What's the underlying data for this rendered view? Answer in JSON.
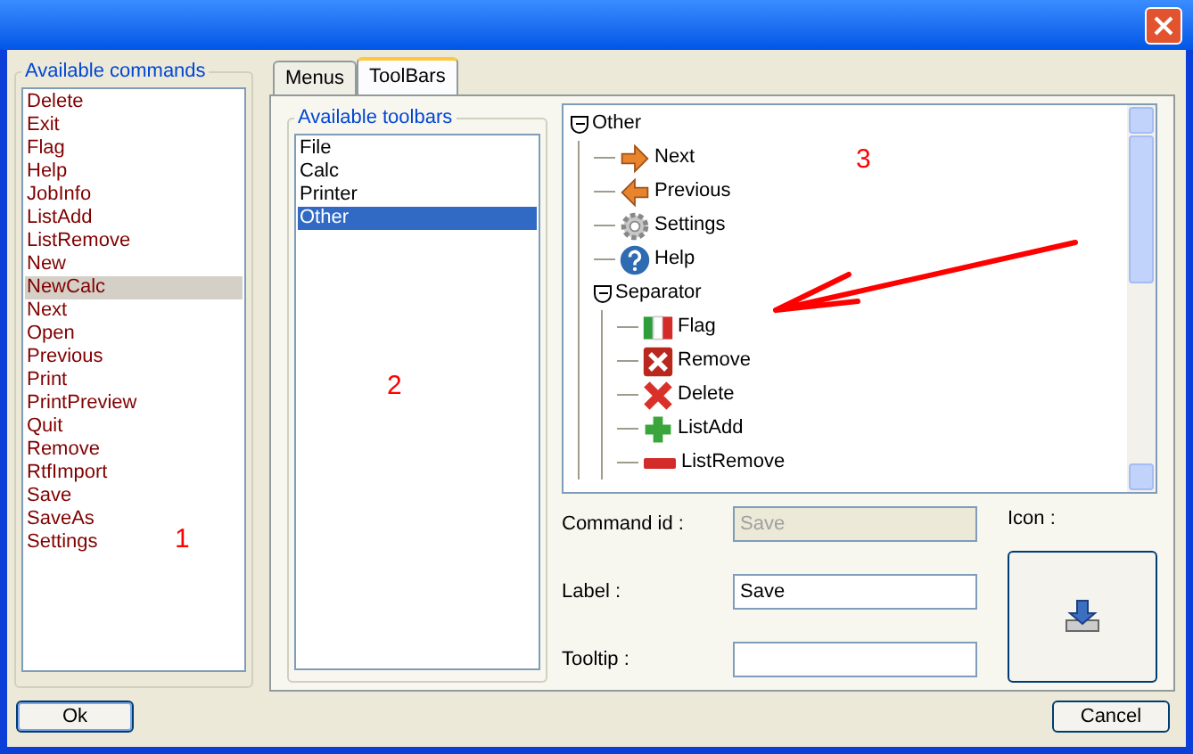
{
  "commands": {
    "title": "Available commands",
    "items": [
      {
        "label": "Delete",
        "selected": false
      },
      {
        "label": "Exit",
        "selected": false
      },
      {
        "label": "Flag",
        "selected": false
      },
      {
        "label": "Help",
        "selected": false
      },
      {
        "label": "JobInfo",
        "selected": false
      },
      {
        "label": "ListAdd",
        "selected": false
      },
      {
        "label": "ListRemove",
        "selected": false
      },
      {
        "label": "New",
        "selected": false
      },
      {
        "label": "NewCalc",
        "selected": true
      },
      {
        "label": "Next",
        "selected": false
      },
      {
        "label": "Open",
        "selected": false
      },
      {
        "label": "Previous",
        "selected": false
      },
      {
        "label": "Print",
        "selected": false
      },
      {
        "label": "PrintPreview",
        "selected": false
      },
      {
        "label": "Quit",
        "selected": false
      },
      {
        "label": "Remove",
        "selected": false
      },
      {
        "label": "RtfImport",
        "selected": false
      },
      {
        "label": "Save",
        "selected": false
      },
      {
        "label": "SaveAs",
        "selected": false
      },
      {
        "label": "Settings",
        "selected": false
      }
    ]
  },
  "tabs": [
    {
      "label": "Menus",
      "selected": false
    },
    {
      "label": "ToolBars",
      "selected": true
    }
  ],
  "toolbars": {
    "title": "Available toolbars",
    "items": [
      {
        "label": "File",
        "selected": false
      },
      {
        "label": "Calc",
        "selected": false
      },
      {
        "label": "Printer",
        "selected": false
      },
      {
        "label": "Other",
        "selected": true
      }
    ]
  },
  "tree": [
    {
      "label": "Other",
      "kind": "group",
      "expanded": true,
      "children": [
        {
          "label": "Next",
          "kind": "next"
        },
        {
          "label": "Previous",
          "kind": "previous"
        },
        {
          "label": "Settings",
          "kind": "settings"
        },
        {
          "label": "Help",
          "kind": "help"
        },
        {
          "label": "Separator",
          "kind": "group",
          "expanded": true,
          "children": [
            {
              "label": "Flag",
              "kind": "flag"
            },
            {
              "label": "Remove",
              "kind": "remove"
            },
            {
              "label": "Delete",
              "kind": "delete"
            },
            {
              "label": "ListAdd",
              "kind": "add"
            },
            {
              "label": "ListRemove",
              "kind": "listremove"
            }
          ]
        }
      ]
    }
  ],
  "form": {
    "command_id": {
      "label": "Command id :",
      "value": "Save",
      "disabled": true
    },
    "label": {
      "label": "Label :",
      "value": "Save"
    },
    "tooltip": {
      "label": "Tooltip :"
    },
    "icon_label": "Icon :"
  },
  "annotations": [
    "1",
    "2",
    "3"
  ],
  "buttons": {
    "ok": "Ok",
    "cancel": "Cancel"
  }
}
